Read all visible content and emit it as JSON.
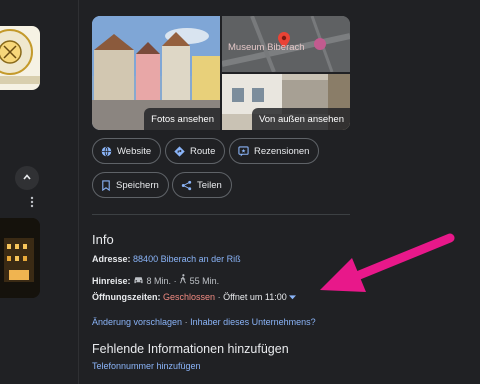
{
  "photos": {
    "main_label": "Fotos ansehen",
    "map_title": "Museum Biberach",
    "street_label": "Von außen ansehen"
  },
  "actions": {
    "website": "Website",
    "route": "Route",
    "reviews": "Rezensionen",
    "save": "Speichern",
    "share": "Teilen"
  },
  "info": {
    "title": "Info",
    "address_label": "Adresse:",
    "address_value": "88400 Biberach an der Riß",
    "directions_label": "Hinreise:",
    "drive_time": "8 Min.",
    "walk_time": "55 Min.",
    "hours_label": "Öffnungszeiten:",
    "status": "Geschlossen",
    "opens": "Öffnet um 11:00",
    "suggest_edit": "Änderung vorschlagen",
    "owner": "Inhaber dieses Unternehmens?",
    "separator": "·"
  },
  "missing": {
    "title": "Fehlende Informationen hinzufügen",
    "phone": "Telefonnummer hinzufügen"
  },
  "colors": {
    "background": "#202124",
    "link": "#8ab4f8",
    "closed": "#f28b82",
    "annotation_arrow": "#e8188a"
  }
}
